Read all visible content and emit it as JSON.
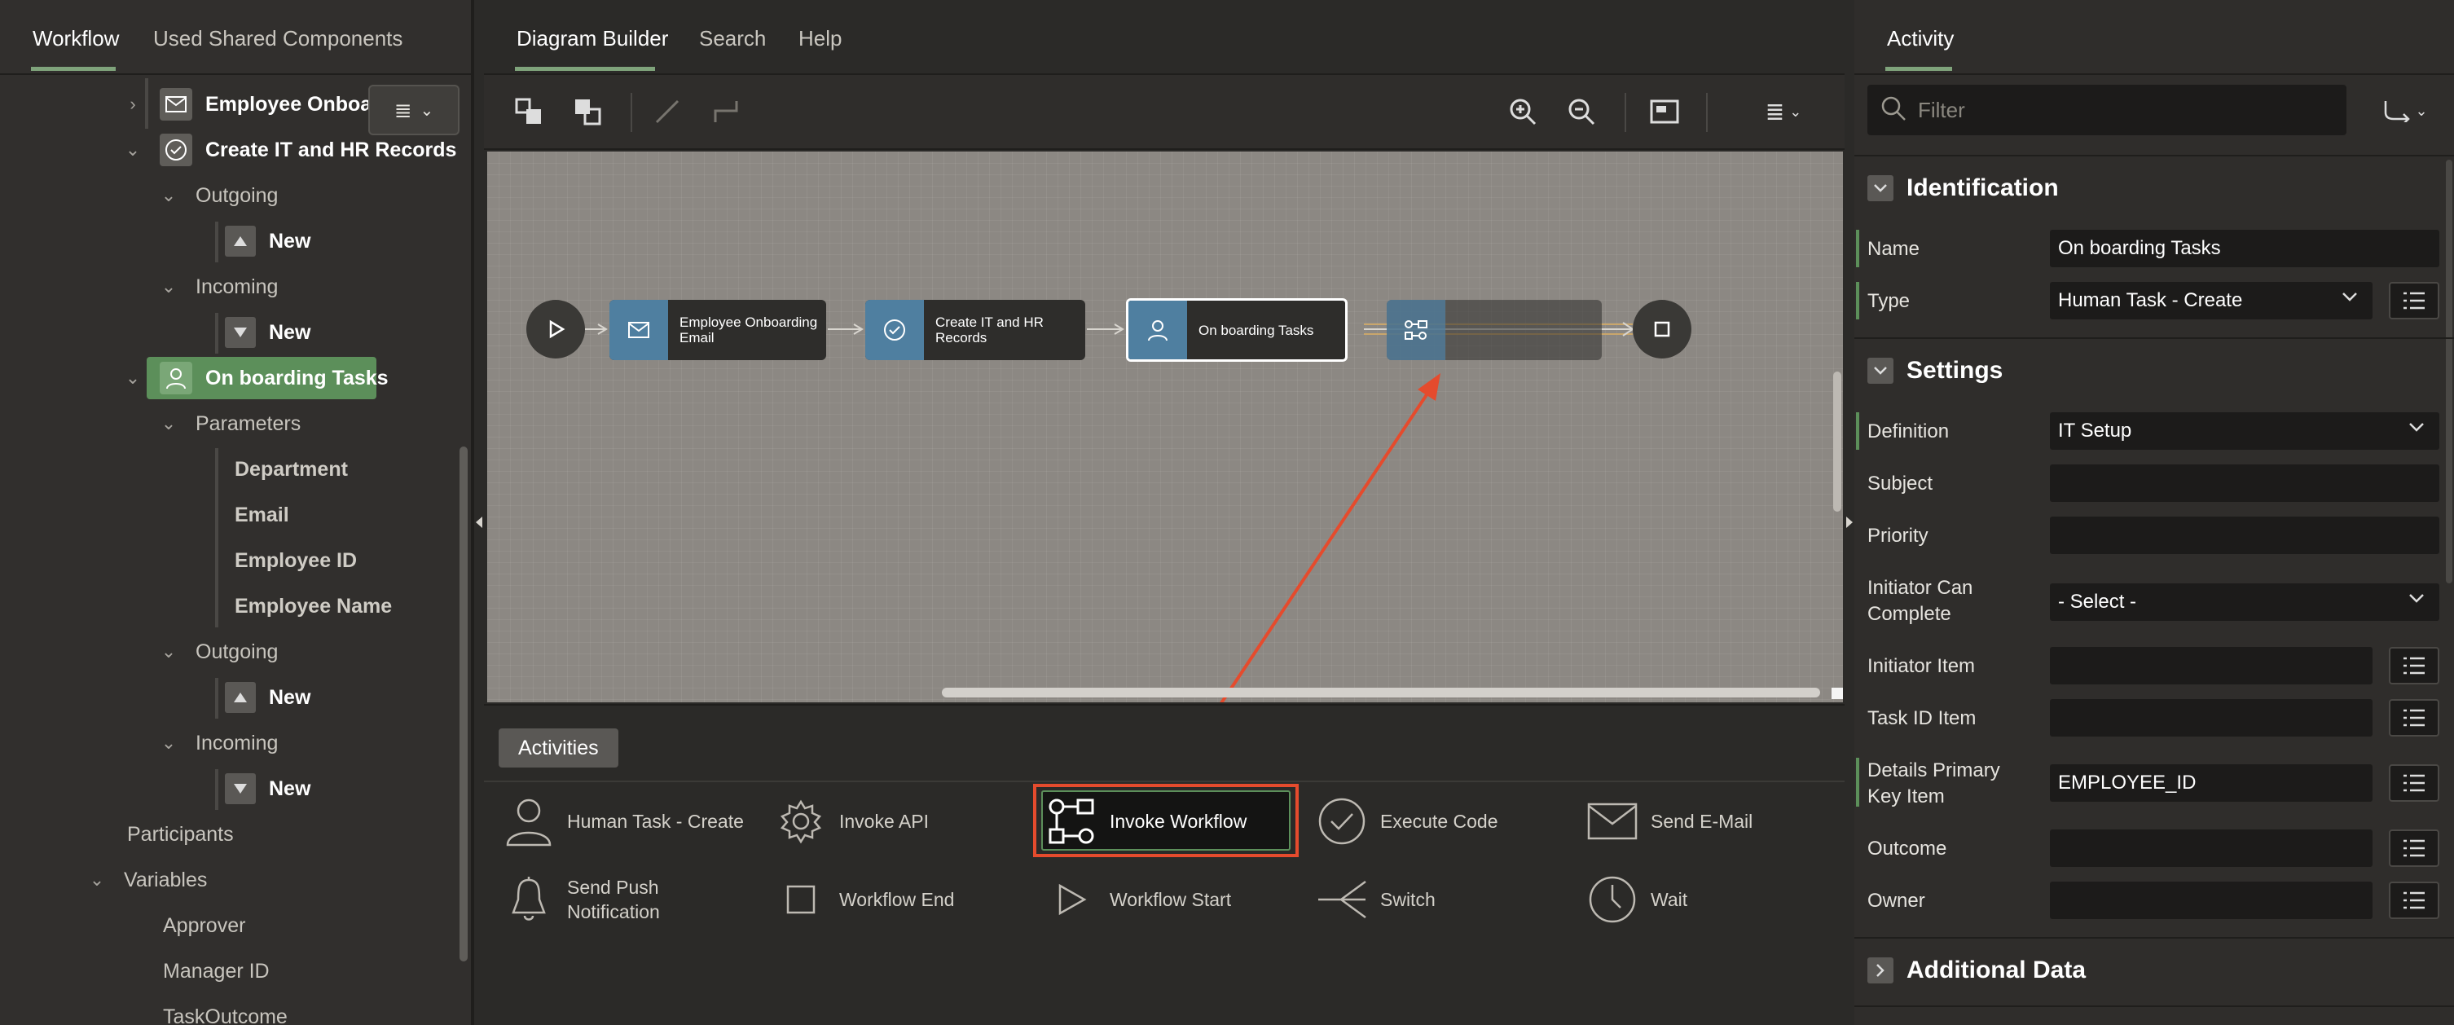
{
  "left": {
    "tabs": [
      "Workflow",
      "Used Shared Components"
    ],
    "tree": {
      "employee_onboard": "Employee Onboard",
      "create_it_hr": "Create IT and HR Records",
      "outgoing": "Outgoing",
      "incoming": "Incoming",
      "new": "New",
      "on_boarding_tasks": "On boarding Tasks",
      "parameters": "Parameters",
      "params": [
        "Department",
        "Email",
        "Employee ID",
        "Employee Name"
      ],
      "participants": "Participants",
      "variables": "Variables",
      "vars": [
        "Approver",
        "Manager ID",
        "TaskOutcome"
      ]
    }
  },
  "center": {
    "tabs": [
      "Diagram Builder",
      "Search",
      "Help"
    ],
    "nodes": {
      "email": "Employee Onboarding Email",
      "create": "Create IT and HR Records",
      "tasks": "On boarding Tasks"
    },
    "palette_title": "Activities",
    "palette": [
      "Human Task - Create",
      "Invoke API",
      "Invoke Workflow",
      "Execute Code",
      "Send E-Mail",
      "Send Push Notification",
      "Workflow End",
      "Workflow Start",
      "Switch",
      "Wait"
    ]
  },
  "right": {
    "tab": "Activity",
    "filter_placeholder": "Filter",
    "sections": {
      "identification": "Identification",
      "settings": "Settings",
      "additional": "Additional Data"
    },
    "props": {
      "name_label": "Name",
      "name_value": "On boarding Tasks",
      "type_label": "Type",
      "type_value": "Human Task - Create",
      "definition_label": "Definition",
      "definition_value": "IT Setup",
      "subject_label": "Subject",
      "priority_label": "Priority",
      "initiator_label": "Initiator Can Complete",
      "initiator_value": "- Select -",
      "initiator_item_label": "Initiator Item",
      "task_id_label": "Task ID Item",
      "details_label": "Details Primary Key Item",
      "details_value": "EMPLOYEE_ID",
      "outcome_label": "Outcome",
      "owner_label": "Owner"
    }
  },
  "colors": {
    "accent": "#5c8f5a",
    "highlight": "#e54b2d",
    "node_icon": "#4f7fa0"
  }
}
